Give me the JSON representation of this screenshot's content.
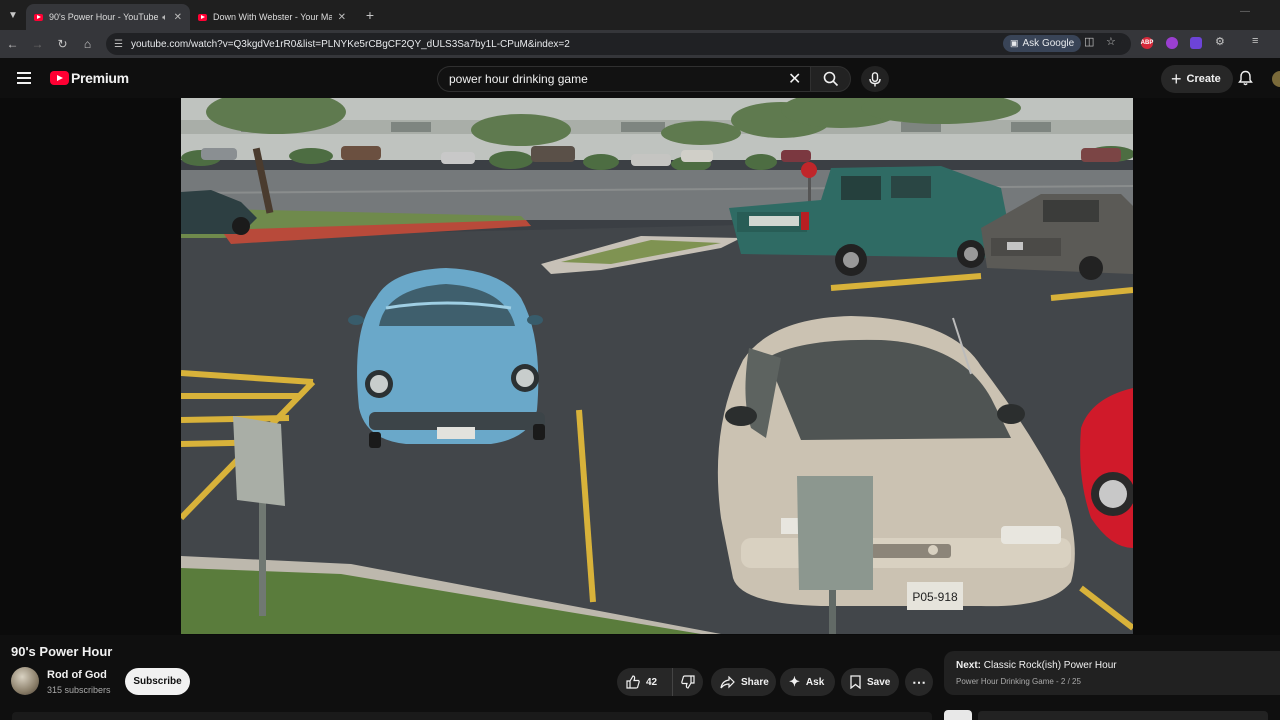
{
  "browser": {
    "tabs": [
      {
        "title": "90's Power Hour - YouTube",
        "active": true,
        "audio_icon": "speaker-icon"
      },
      {
        "title": "Down With Webster - Your Man",
        "active": false
      }
    ],
    "url": "youtube.com/watch?v=Q3kgdVe1rR0&list=PLNYKe5rCBgCF2QY_dULS3Sa7by1L-CPuM&index=2",
    "ask_google_label": "Ask Google",
    "extensions": [
      {
        "name": "abp-extension-icon",
        "color": "#d6293a",
        "label": "ABP"
      },
      {
        "name": "purple-extension-icon",
        "color": "#9b3fd1",
        "label": ""
      },
      {
        "name": "shield-extension-icon",
        "color": "#6d44d8",
        "label": ""
      }
    ]
  },
  "youtube": {
    "logo_text": "Premium",
    "search_query": "power hour drinking game",
    "create_label": "Create",
    "brand_red": "#ff0033"
  },
  "video": {
    "title": "90's Power Hour",
    "channel_name": "Rod of God",
    "subscribers": "315 subscribers",
    "subscribe_label": "Subscribe",
    "like_count": "42",
    "share_label": "Share",
    "ask_label": "Ask",
    "save_label": "Save",
    "frame_plate": "P05-918"
  },
  "up_next": {
    "prefix": "Next:",
    "title": "Classic Rock(ish) Power Hour",
    "playlist": "Power Hour Drinking Game - 2 / 25"
  }
}
